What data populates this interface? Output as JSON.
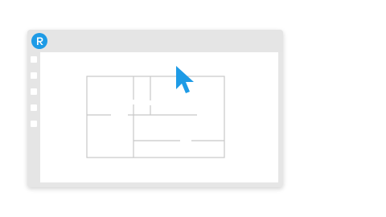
{
  "app": {
    "logo_icon": "bluebeam-revu-logo-icon",
    "accent_color": "#1e9be6"
  },
  "toolbar": {
    "tool_icons": [
      "tool-icon",
      "tool-icon",
      "tool-icon",
      "tool-icon",
      "tool-icon"
    ]
  },
  "canvas": {
    "content": "floor-plan-drawing",
    "line_color": "#c8c8c8"
  },
  "cursor": {
    "icon": "arrow-cursor-icon",
    "color": "#1e9be6"
  }
}
